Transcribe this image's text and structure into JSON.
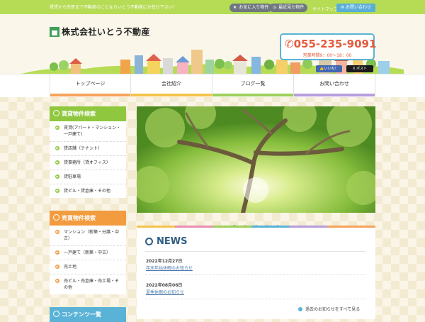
{
  "topbar": {
    "tagline": "賃貸から売買まで不動産のことならいとう不動産にお任せ下さい！",
    "favorites_label": "お気に入り物件",
    "recent_label": "最近見た物件",
    "sitemap_label": "サイトマップ",
    "contact_label": "お問い合わせ"
  },
  "header": {
    "company": "株式会社いとう不動産",
    "phone": "055-235-9091",
    "hours": "営業時間9：00～18：00",
    "fb_label": "いいね！",
    "tw_label": "ポスト"
  },
  "nav": [
    {
      "label": "トップページ",
      "color": "#f7a35c"
    },
    {
      "label": "会社紹介",
      "color": "#f6c24a"
    },
    {
      "label": "ブログ一覧",
      "color": "#9ed05a"
    },
    {
      "label": "お問い合わせ",
      "color": "#b79ddd"
    }
  ],
  "sidebar": {
    "rent": {
      "title": "賃貸物件検索",
      "color": "#8fc83f",
      "items": [
        "賃貸(アパート・マンション・一戸建て)",
        "貸店舗（テナント）",
        "貸事務所（貸オフィス）",
        "貸駐車場",
        "貸ビル・貸倉庫・その他"
      ]
    },
    "sale": {
      "title": "売買物件検索",
      "color": "#f29c3f",
      "items": [
        "マンション（新築・分譲・中古）",
        "一戸建て（新築・中古）",
        "売土地",
        "売ビル・売倉庫・売工場・その他"
      ]
    },
    "contents": {
      "title": "コンテンツ一覧",
      "color": "#5ab3d6"
    }
  },
  "news": {
    "title": "NEWS",
    "items": [
      {
        "date": "2022年12月27日",
        "text": "年末年始休暇のお知らせ"
      },
      {
        "date": "2022年08月06日",
        "text": "夏季休暇のお知らせ"
      }
    ],
    "more_label": "過去のお知らせをすべて見る"
  },
  "slider": {
    "dot_count": 5,
    "active_index": 0
  }
}
